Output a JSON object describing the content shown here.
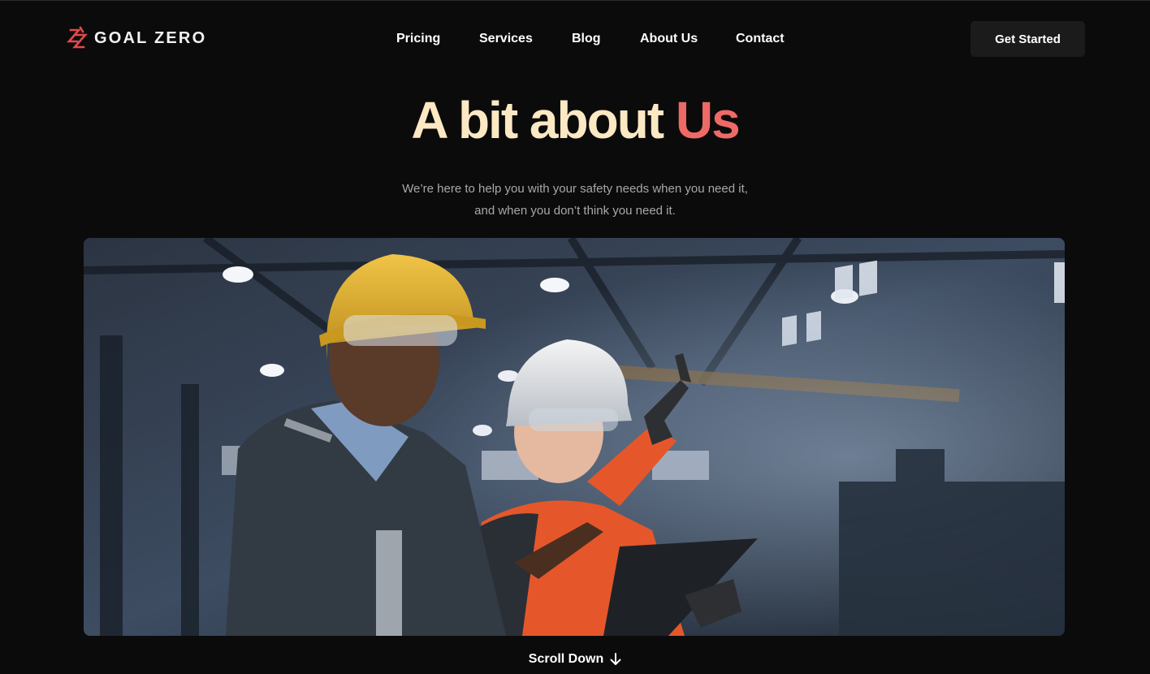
{
  "brand": {
    "name": "GOAL ZERO",
    "accent": "#e24a4a"
  },
  "nav": {
    "items": [
      "Pricing",
      "Services",
      "Blog",
      "About Us",
      "Contact"
    ],
    "cta": "Get Started"
  },
  "hero": {
    "title_part1": "A bit about",
    "title_part2": "Us",
    "title_color": "#fde8c4",
    "highlight_color": "#ee6a67",
    "subtitle_line1": "We’re here to help you with your safety needs when you need it,",
    "subtitle_line2": "and when you don’t think you need it."
  },
  "image": {
    "subject": "two industrial workers in hard hats and safety glasses in a factory"
  },
  "scroll": {
    "label": "Scroll Down",
    "icon": "arrow-down-icon"
  }
}
